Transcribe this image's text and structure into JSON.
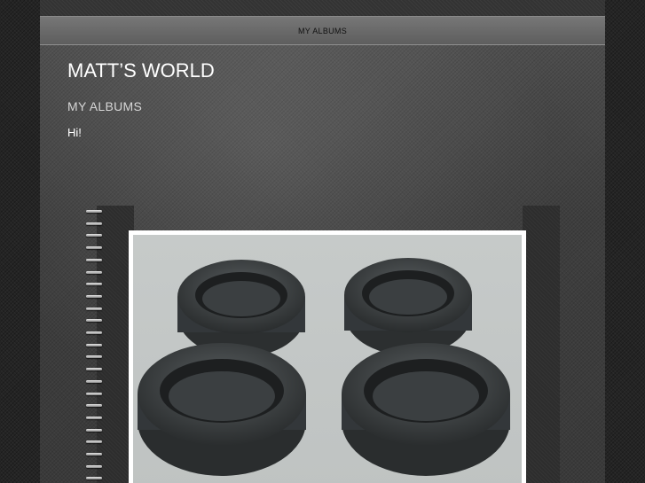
{
  "nav": {
    "items": [
      {
        "label": "MY ALBUMS"
      }
    ]
  },
  "header": {
    "site_title": "MATT’S WORLD"
  },
  "main": {
    "page_heading": "MY ALBUMS",
    "intro_text": "Hi!"
  },
  "album": {
    "photo_subject": "four-tires"
  },
  "colors": {
    "page_bg": "#4a4a4a",
    "outer_bg": "#242424",
    "nav_bg": "#6a6a6a",
    "title_color": "#ffffff",
    "heading_color": "#d6d6d6"
  }
}
